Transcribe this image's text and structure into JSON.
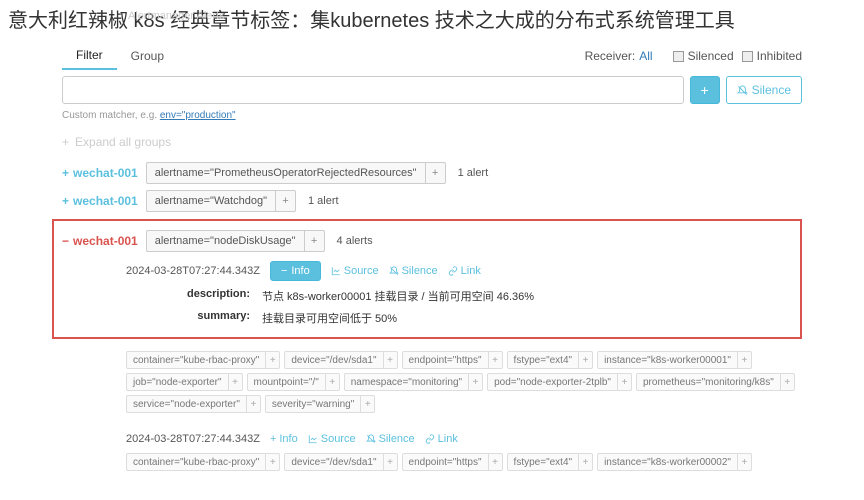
{
  "page_title": "意大利红辣椒 k8s 经典章节标签：集kubernetes 技术之大成的分布式系统管理工具",
  "faint_bg_text": "Alertmanager   Alerts",
  "nav": {
    "filter": "Filter",
    "group": "Group",
    "receiver_label": "Receiver:",
    "receiver_value": "All",
    "silenced": "Silenced",
    "inhibited": "Inhibited"
  },
  "search": {
    "placeholder": "",
    "add_symbol": "+",
    "silence_btn": "Silence"
  },
  "hint": {
    "prefix": "Custom matcher, e.g. ",
    "example": "env=\"production\""
  },
  "expand_all": "Expand all groups",
  "groups": [
    {
      "toggle_symbol": "+",
      "receiver": "wechat-001",
      "matcher": "alertname=\"PrometheusOperatorRejectedResources\"",
      "count": "1 alert"
    },
    {
      "toggle_symbol": "+",
      "receiver": "wechat-001",
      "matcher": "alertname=\"Watchdog\"",
      "count": "1 alert"
    }
  ],
  "expanded_group": {
    "toggle_symbol": "−",
    "receiver": "wechat-001",
    "matcher": "alertname=\"nodeDiskUsage\"",
    "count": "4 alerts",
    "alert": {
      "timestamp": "2024-03-28T07:27:44.343Z",
      "info_btn": "Info",
      "source_btn": "Source",
      "silence_btn": "Silence",
      "link_btn": "Link",
      "description_key": "description:",
      "description_val": "节点 k8s-worker00001 挂载目录 / 当前可用空间 46.36%",
      "summary_key": "summary:",
      "summary_val": "挂载目录可用空间低于 50%",
      "tags": [
        "container=\"kube-rbac-proxy\"",
        "device=\"/dev/sda1\"",
        "endpoint=\"https\"",
        "fstype=\"ext4\"",
        "instance=\"k8s-worker00001\"",
        "job=\"node-exporter\"",
        "mountpoint=\"/\"",
        "namespace=\"monitoring\"",
        "pod=\"node-exporter-2tplb\"",
        "prometheus=\"monitoring/k8s\"",
        "service=\"node-exporter\"",
        "severity=\"warning\""
      ]
    }
  },
  "second_alert": {
    "timestamp": "2024-03-28T07:27:44.343Z",
    "info_btn": "Info",
    "source_btn": "Source",
    "silence_btn": "Silence",
    "link_btn": "Link",
    "tags": [
      "container=\"kube-rbac-proxy\"",
      "device=\"/dev/sda1\"",
      "endpoint=\"https\"",
      "fstype=\"ext4\"",
      "instance=\"k8s-worker00002\""
    ]
  },
  "icons": {
    "plus": "+",
    "minus": "−",
    "bell": "🔕",
    "chart": "📊",
    "link": "🔗",
    "expand": "+"
  }
}
